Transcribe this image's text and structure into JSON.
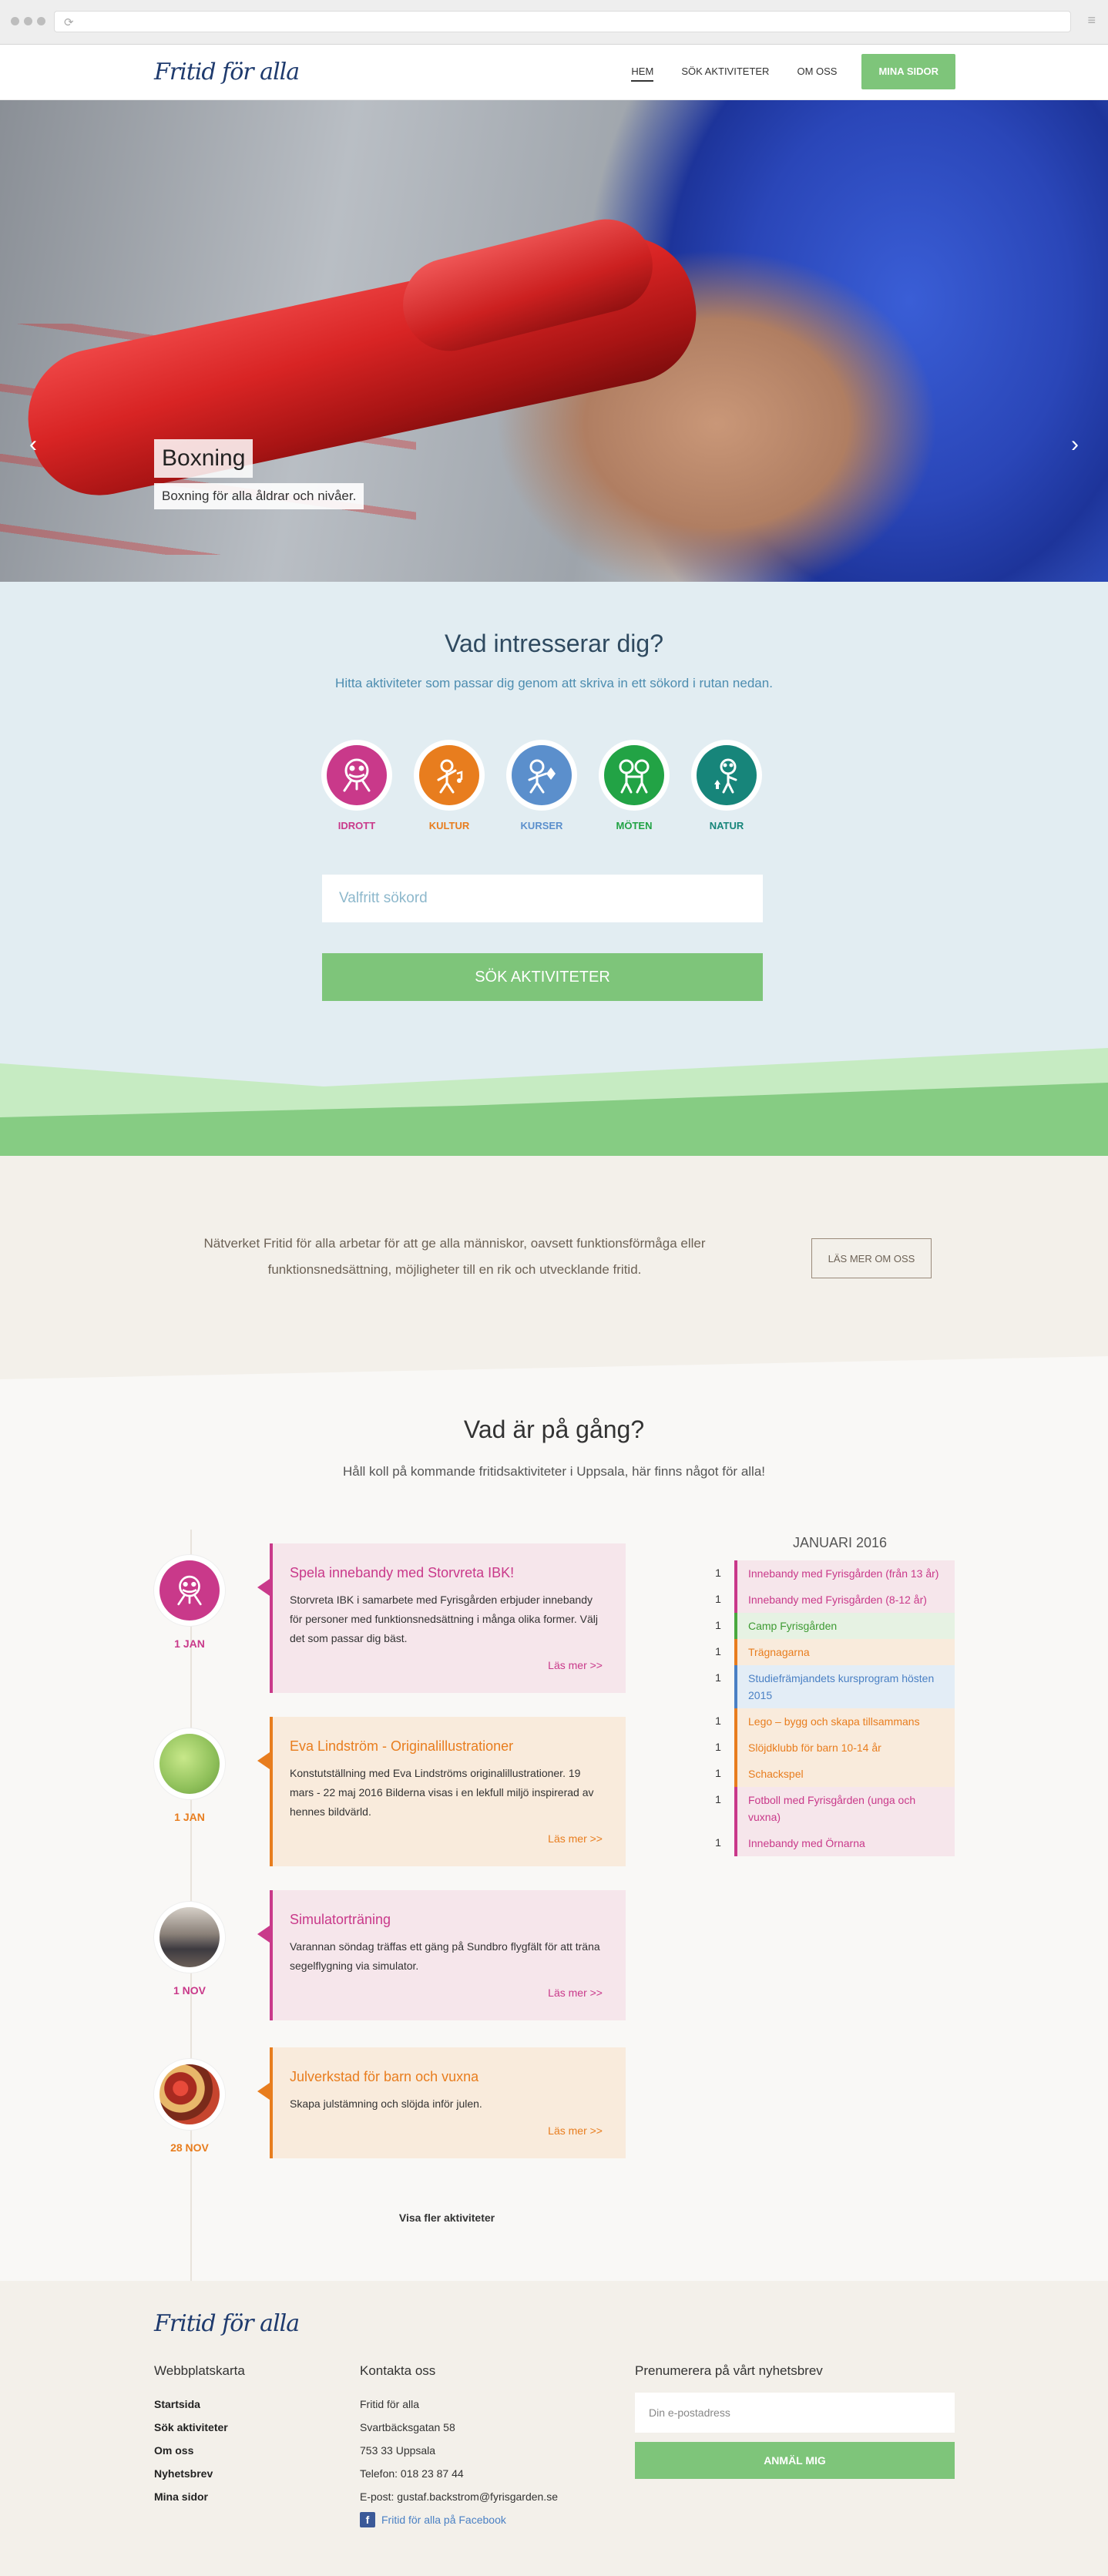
{
  "header": {
    "logo": "Fritid för alla",
    "nav": [
      {
        "label": "HEM",
        "active": true
      },
      {
        "label": "SÖK AKTIVITETER",
        "active": false
      },
      {
        "label": "OM OSS",
        "active": false
      }
    ],
    "cta": "MINA SIDOR"
  },
  "hero": {
    "title": "Boxning",
    "subtitle": "Boxning för alla åldrar och nivåer.",
    "slides": 3,
    "active_slide": 1
  },
  "search": {
    "title": "Vad intresserar dig?",
    "lead": "Hitta aktiviteter som passar dig genom att skriva in ett sökord i rutan nedan.",
    "categories": [
      {
        "label": "IDROTT",
        "color": "#c9398a",
        "icon": "sports-people-icon"
      },
      {
        "label": "KULTUR",
        "color": "#e87d1e",
        "icon": "culture-people-icon"
      },
      {
        "label": "KURSER",
        "color": "#5b8fcc",
        "icon": "courses-people-icon"
      },
      {
        "label": "MÖTEN",
        "color": "#22a345",
        "icon": "meetings-people-icon"
      },
      {
        "label": "NATUR",
        "color": "#17857a",
        "icon": "nature-people-icon"
      }
    ],
    "placeholder": "Valfritt sökord",
    "button": "SÖK AKTIVITETER"
  },
  "about": {
    "text": "Nätverket Fritid för alla arbetar för att ge alla människor, oavsett funktionsförmåga eller funktionsnedsättning, möjligheter till en rik och utvecklande fritid.",
    "button": "LÄS MER OM OSS"
  },
  "events": {
    "title": "Vad är på gång?",
    "lead": "Håll koll på kommande fritidsaktiviteter i Uppsala, här finns något för alla!",
    "items": [
      {
        "title": "Spela innebandy med Storvreta IBK!",
        "desc": "Storvreta IBK i samarbete med Fyrisgården erbjuder innebandy för personer med funktionsnedsättning i många olika former. Välj det som passar dig bäst.",
        "more": "Läs mer >>",
        "date": "1 JAN"
      },
      {
        "title": "Eva Lindström - Originalillustrationer",
        "desc": "Konstutställning med Eva Lindströms originalillustrationer. 19 mars - 22 maj 2016 Bilderna visas i en lekfull miljö inspirerad av hennes bildvärld.",
        "more": "Läs mer >>",
        "date": "1 JAN"
      },
      {
        "title": "Simulatorträning",
        "desc": "Varannan söndag träffas ett gäng på Sundbro flygfält för att träna segelflygning via simulator.",
        "more": "Läs mer >>",
        "date": "1 NOV"
      },
      {
        "title": "Julverkstad för barn och vuxna",
        "desc": "Skapa julstämning och slöjda inför julen.",
        "more": "Läs mer >>",
        "date": "28 NOV"
      }
    ],
    "show_more": "Visa fler aktiviteter"
  },
  "calendar": {
    "title": "JANUARI 2016",
    "items": [
      {
        "day": "1",
        "label": "Innebandy med Fyrisgården (från 13 år)",
        "color": "pink"
      },
      {
        "day": "1",
        "label": "Innebandy med Fyrisgården (8-12 år)",
        "color": "pink"
      },
      {
        "day": "1",
        "label": "Camp Fyrisgården",
        "color": "green"
      },
      {
        "day": "1",
        "label": "Trägnagarna",
        "color": "orange"
      },
      {
        "day": "1",
        "label": "Studiefrämjandets kursprogram hösten 2015",
        "color": "blue"
      },
      {
        "day": "1",
        "label": "Lego – bygg och skapa tillsammans",
        "color": "orange"
      },
      {
        "day": "1",
        "label": "Slöjdklubb för barn 10-14 år",
        "color": "orange"
      },
      {
        "day": "1",
        "label": "Schackspel",
        "color": "orange"
      },
      {
        "day": "1",
        "label": "Fotboll med Fyrisgården (unga och vuxna)",
        "color": "pink"
      },
      {
        "day": "1",
        "label": "Innebandy med Örnarna",
        "color": "pink"
      }
    ]
  },
  "footer": {
    "logo": "Fritid för alla",
    "sitemap_title": "Webbplatskarta",
    "sitemap": [
      "Startsida",
      "Sök aktiviteter",
      "Om oss",
      "Nyhetsbrev",
      "Mina sidor"
    ],
    "contact_title": "Kontakta oss",
    "contact": [
      "Fritid för alla",
      "Svartbäcksgatan 58",
      "753 33 Uppsala",
      "Telefon: 018 23 87 44",
      "E-post: gustaf.backstrom@fyrisgarden.se"
    ],
    "facebook": "Fritid för alla på Facebook",
    "newsletter_title": "Prenumerera på vårt nyhetsbrev",
    "newsletter_placeholder": "Din e-postadress",
    "newsletter_button": "ANMÄL MIG"
  }
}
